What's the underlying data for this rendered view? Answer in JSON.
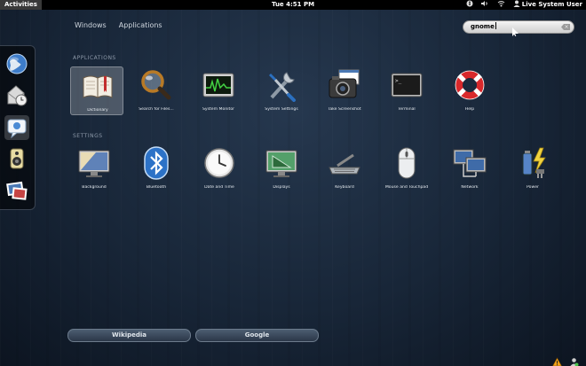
{
  "top_panel": {
    "activities": "Activities",
    "clock": "Tue  4:51 PM",
    "user": "Live System User",
    "tray_icons": [
      "accessibility-icon",
      "volume-icon",
      "network-wireless-icon",
      "user-status-icon"
    ]
  },
  "view_tabs": {
    "windows": "Windows",
    "applications": "Applications"
  },
  "search": {
    "value": "gnome",
    "clear_icon": "clear-icon"
  },
  "dash": {
    "items": [
      "web-browser",
      "empathy-chat",
      "messaging",
      "rhythmbox",
      "shotwell"
    ]
  },
  "sections": {
    "applications_title": "APPLICATIONS",
    "settings_title": "SETTINGS"
  },
  "applications": [
    {
      "label": "Dictionary",
      "icon": "dictionary-icon"
    },
    {
      "label": "Search for Files...",
      "icon": "search-files-icon"
    },
    {
      "label": "System Monitor",
      "icon": "system-monitor-icon"
    },
    {
      "label": "System Settings",
      "icon": "system-settings-icon"
    },
    {
      "label": "Take Screenshot",
      "icon": "screenshot-icon"
    },
    {
      "label": "Terminal",
      "icon": "terminal-icon"
    },
    {
      "label": "Help",
      "icon": "help-icon"
    }
  ],
  "settings": [
    {
      "label": "Background",
      "icon": "background-icon"
    },
    {
      "label": "Bluetooth",
      "icon": "bluetooth-icon"
    },
    {
      "label": "Date and Time",
      "icon": "clock-icon"
    },
    {
      "label": "Displays",
      "icon": "displays-icon"
    },
    {
      "label": "Keyboard",
      "icon": "keyboard-icon"
    },
    {
      "label": "Mouse and Touchpad",
      "icon": "mouse-icon"
    },
    {
      "label": "Network",
      "icon": "network-icon"
    },
    {
      "label": "Power",
      "icon": "power-icon"
    }
  ],
  "search_providers": {
    "wikipedia": "Wikipedia",
    "google": "Google"
  },
  "bottom_tray": [
    "warning-icon",
    "user-icon"
  ],
  "colors": {
    "panel": "#000000",
    "background": "#1b2a3d",
    "accent": "#d6e2ee"
  }
}
